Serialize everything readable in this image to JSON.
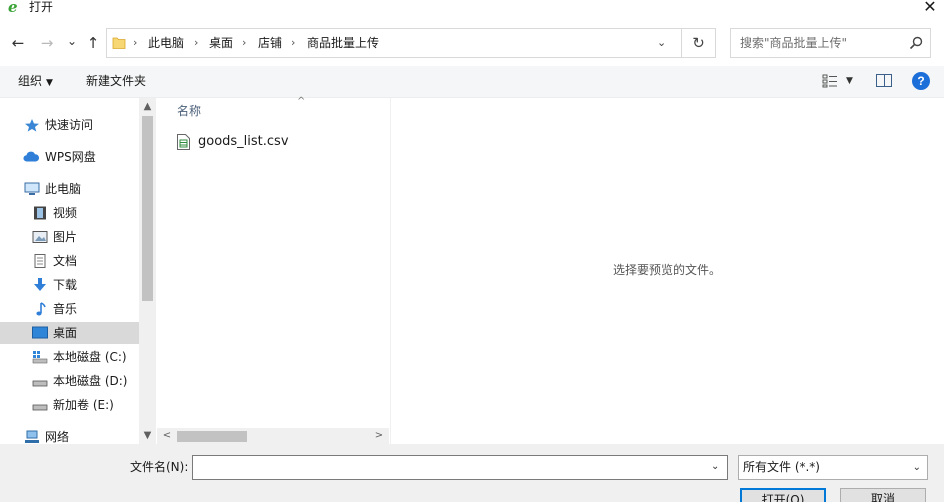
{
  "window": {
    "title": "打开",
    "app_icon": "e-browser-icon"
  },
  "nav": {
    "back": "←",
    "forward": "→",
    "recent": "⌄",
    "up": "↑",
    "breadcrumb": [
      "此电脑",
      "桌面",
      "店铺",
      "商品批量上传"
    ],
    "separator": "›",
    "dropdown": "⌄",
    "refresh": "↻"
  },
  "search": {
    "placeholder": "搜索\"商品批量上传\""
  },
  "toolbar": {
    "organize": "组织",
    "new_folder": "新建文件夹",
    "view_drop": "▼",
    "help": "?"
  },
  "sidebar": {
    "items": [
      {
        "label": "快速访问",
        "icon": "star-icon"
      },
      {
        "label": "WPS网盘",
        "icon": "cloud-icon"
      },
      {
        "label": "此电脑",
        "icon": "computer-icon"
      },
      {
        "label": "视频",
        "icon": "video-icon"
      },
      {
        "label": "图片",
        "icon": "picture-icon"
      },
      {
        "label": "文档",
        "icon": "document-icon"
      },
      {
        "label": "下载",
        "icon": "download-icon"
      },
      {
        "label": "音乐",
        "icon": "music-icon"
      },
      {
        "label": "桌面",
        "icon": "desktop-icon",
        "selected": true
      },
      {
        "label": "本地磁盘 (C:)",
        "icon": "drive-c-icon"
      },
      {
        "label": "本地磁盘 (D:)",
        "icon": "drive-icon"
      },
      {
        "label": "新加卷 (E:)",
        "icon": "drive-icon"
      },
      {
        "label": "网络",
        "icon": "network-icon"
      }
    ],
    "scroll_up": "▲",
    "scroll_down": "▼"
  },
  "filelist": {
    "column_name": "名称",
    "sort_arrow": "^",
    "files": [
      {
        "name": "goods_list.csv",
        "icon": "csv-file-icon"
      }
    ],
    "scroll_left": "<",
    "scroll_right": ">"
  },
  "preview": {
    "message": "选择要预览的文件。"
  },
  "bottom": {
    "filename_label": "文件名(N):",
    "filename_value": "",
    "filename_drop": "⌄",
    "filter_value": "所有文件 (*.*)",
    "filter_drop": "⌄",
    "open_button": "打开(O)",
    "cancel_button": "取消"
  },
  "colors": {
    "accent": "#0078d7",
    "selected_bg": "#d9d9d9",
    "help_blue": "#1c6ed8"
  }
}
